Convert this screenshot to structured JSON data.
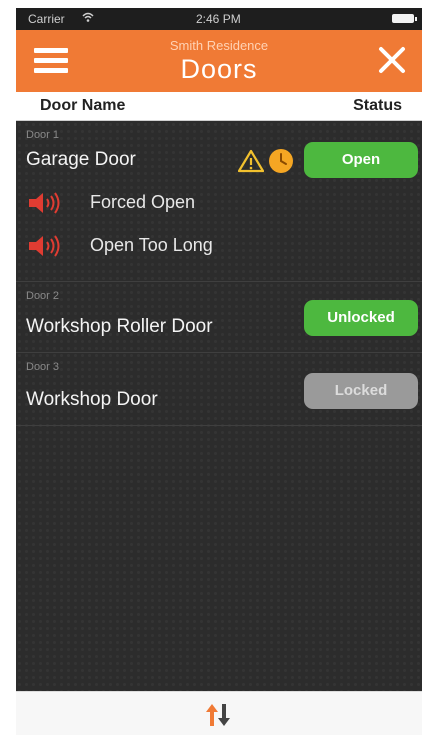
{
  "status_bar": {
    "carrier": "Carrier",
    "time": "2:46 PM"
  },
  "header": {
    "subtitle": "Smith Residence",
    "title": "Doors"
  },
  "columns": {
    "door_name": "Door Name",
    "status": "Status"
  },
  "doors": [
    {
      "number": "Door 1",
      "name": "Garage Door",
      "status": "Open",
      "alarms": [
        "Forced Open",
        "Open Too Long"
      ]
    },
    {
      "number": "Door 2",
      "name": "Workshop Roller Door",
      "status": "Unlocked"
    },
    {
      "number": "Door 3",
      "name": "Workshop Door",
      "status": "Locked"
    }
  ],
  "colors": {
    "header": "#f07a35",
    "open": "#4db83f",
    "locked": "#9a9a9a",
    "alarm": "#e03c32",
    "warning": "#f2c12e",
    "clock_badge": "#f5a623"
  },
  "icons": {
    "menu": "hamburger-icon",
    "close": "close-icon",
    "warning": "warning-triangle-icon",
    "clock": "clock-icon",
    "alarm": "siren-speaker-icon",
    "sort": "sort-arrows-icon",
    "wifi": "wifi-icon",
    "battery": "battery-icon"
  }
}
